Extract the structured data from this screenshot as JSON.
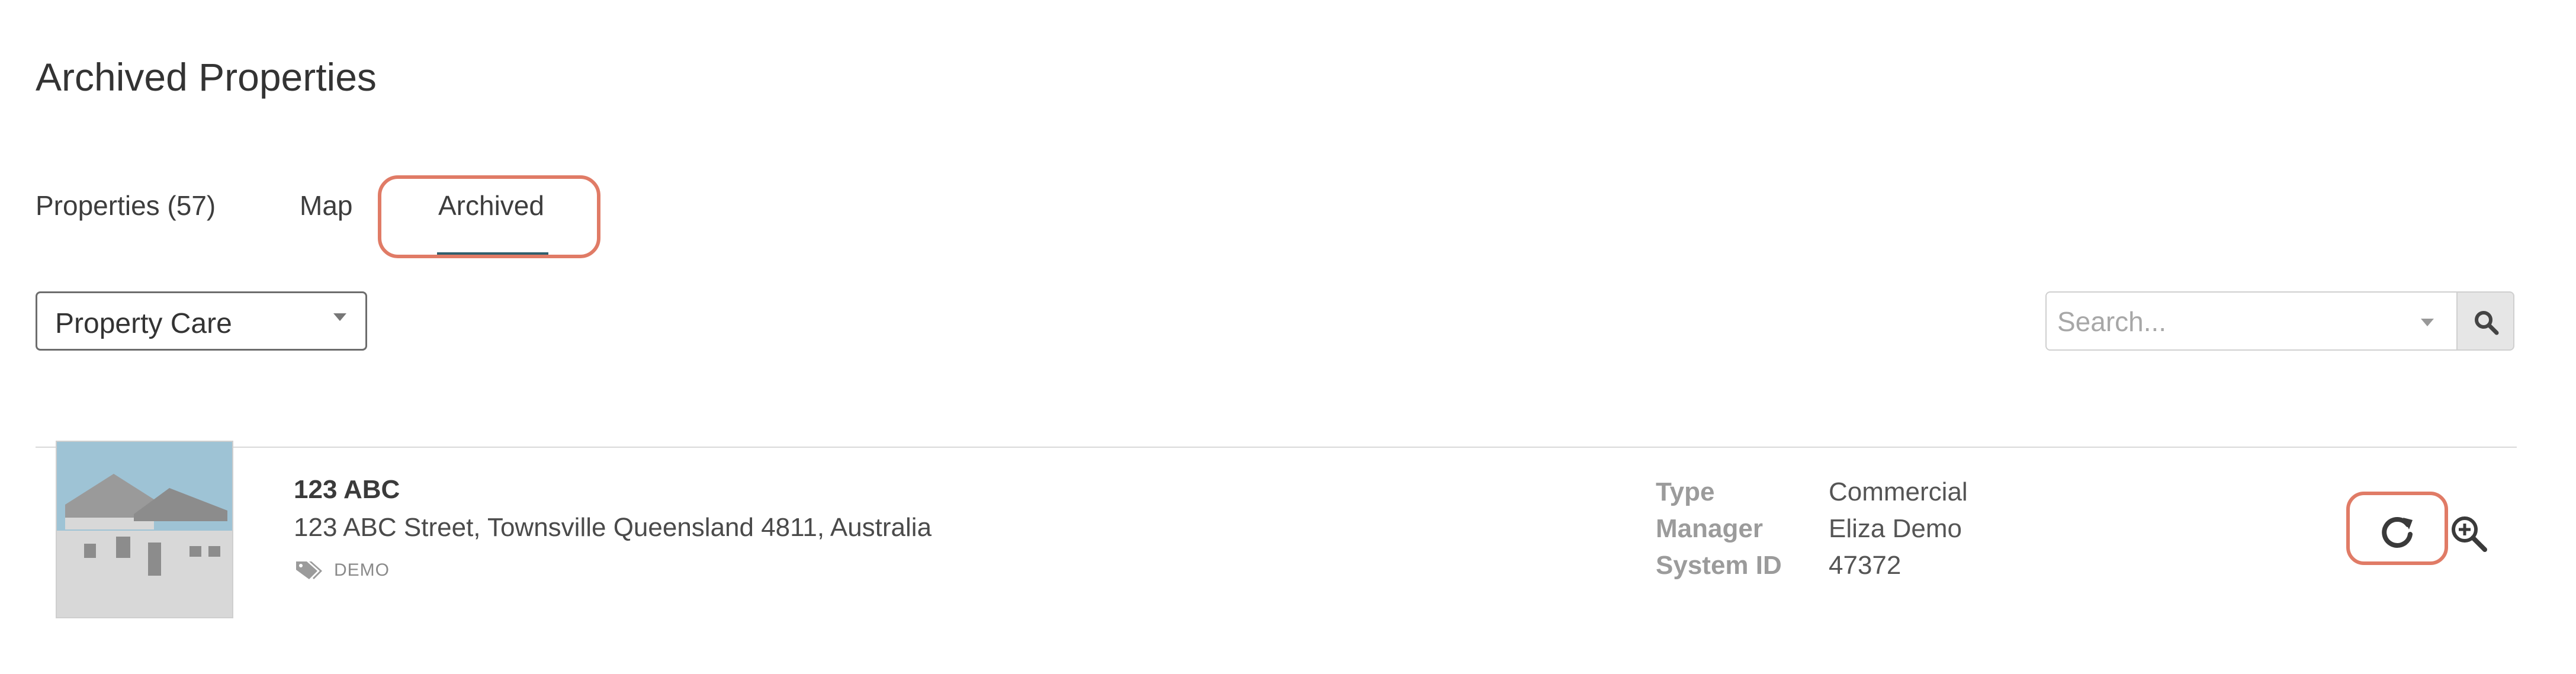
{
  "page": {
    "title": "Archived Properties"
  },
  "tabs": [
    {
      "label": "Properties (57)",
      "active": false
    },
    {
      "label": "Map",
      "active": false
    },
    {
      "label": "Archived",
      "active": true
    }
  ],
  "filter": {
    "selected": "Property Care"
  },
  "search": {
    "placeholder": "Search..."
  },
  "properties": [
    {
      "name": "123 ABC",
      "address": "123 ABC Street, Townsville Queensland 4811, Australia",
      "tag": "DEMO",
      "details": [
        {
          "label": "Type",
          "value": "Commercial"
        },
        {
          "label": "Manager",
          "value": "Eliza Demo"
        },
        {
          "label": "System ID",
          "value": "47372"
        }
      ],
      "actions": {
        "restore_icon": "restore-icon",
        "view_icon": "zoom-in-icon"
      }
    }
  ],
  "colors": {
    "accent_underline": "#2f5f6e",
    "highlight_outline": "#e07b66",
    "thumb_sky": "#9ec3d5",
    "thumb_house": "#8c8c8c"
  }
}
